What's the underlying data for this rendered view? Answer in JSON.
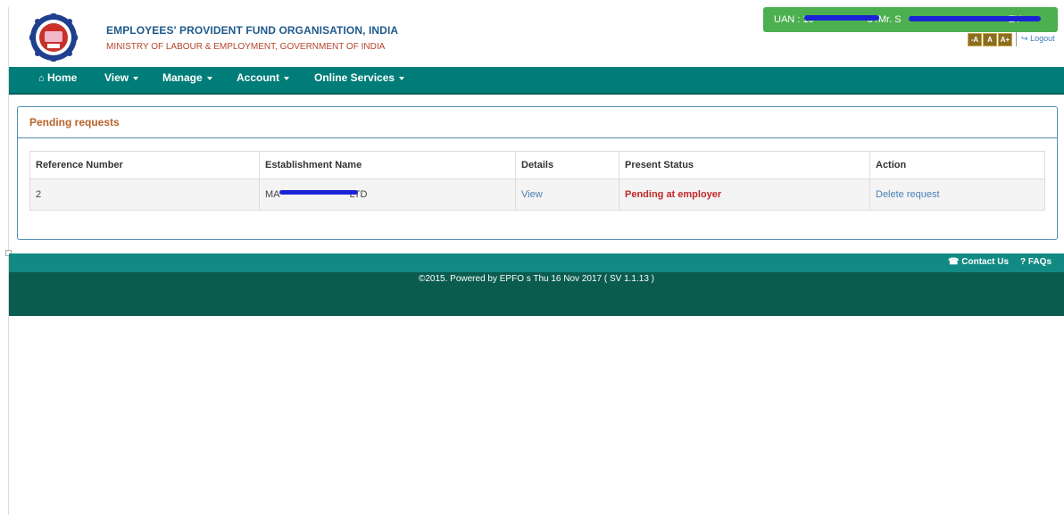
{
  "header": {
    "org_title": "EMPLOYEES' PROVIDENT FUND ORGANISATION, INDIA",
    "org_subtitle": "MINISTRY OF LABOUR & EMPLOYMENT, GOVERNMENT OF INDIA",
    "uan_prefix": "UAN : 10",
    "uan_mid": "3 /Mr. S",
    "uan_suffix": "EY",
    "font_buttons": [
      "-A",
      "A",
      "A+"
    ],
    "logout_label": "Logout"
  },
  "nav": {
    "items": [
      {
        "label": "Home",
        "icon": "home-icon"
      },
      {
        "label": "View",
        "dropdown": true
      },
      {
        "label": "Manage",
        "dropdown": true
      },
      {
        "label": "Account",
        "dropdown": true
      },
      {
        "label": "Online Services",
        "dropdown": true
      }
    ]
  },
  "panel": {
    "title": "Pending requests",
    "columns": [
      "Reference Number",
      "Establishment Name",
      "Details",
      "Present Status",
      "Action"
    ],
    "rows": [
      {
        "ref": "2",
        "establishment": "MA",
        "establishment_tail": "LTD",
        "details": "View",
        "status": "Pending at employer",
        "action": "Delete request"
      }
    ]
  },
  "footer": {
    "contact_label": "Contact Us",
    "faq_label": "FAQs",
    "copyright": "©2015. Powered by EPFO s Thu 16 Nov 2017 ( SV 1.1.13 )"
  },
  "colors": {
    "nav": "#007d78",
    "uan_box": "#4caf50",
    "footer_dark": "#0a5c4f",
    "status_red": "#c0282b",
    "panel_title": "#b8632a"
  }
}
